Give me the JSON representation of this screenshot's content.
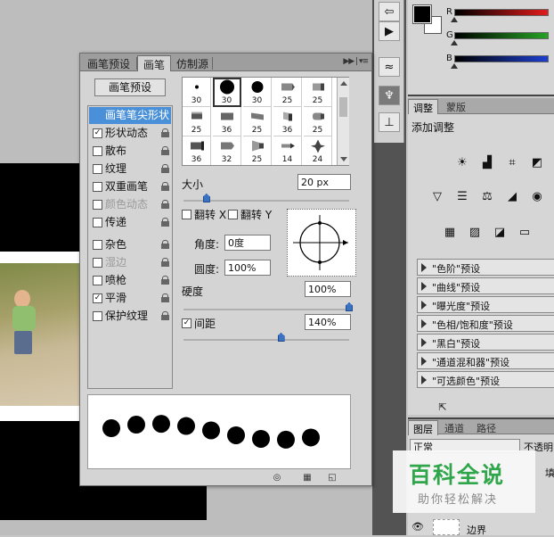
{
  "colors": {
    "accent_blue": "#4a90d9",
    "slider_blue": "#3b73c4",
    "watermark_green": "#2fa64a"
  },
  "brush_dialog": {
    "tabs": [
      {
        "label": "画笔预设"
      },
      {
        "label": "画笔",
        "active": true
      },
      {
        "label": "仿制源"
      }
    ],
    "menu_icon": "panel-menu-icon",
    "preset_button_label": "画笔预设",
    "options": [
      {
        "label": "画笔笔尖形状",
        "checkbox": false,
        "checked": false,
        "selected": true,
        "disabled": false,
        "lock": false
      },
      {
        "label": "形状动态",
        "checkbox": true,
        "checked": true,
        "selected": false,
        "disabled": false,
        "lock": true
      },
      {
        "label": "散布",
        "checkbox": true,
        "checked": false,
        "selected": false,
        "disabled": false,
        "lock": true
      },
      {
        "label": "纹理",
        "checkbox": true,
        "checked": false,
        "selected": false,
        "disabled": false,
        "lock": true
      },
      {
        "label": "双重画笔",
        "checkbox": true,
        "checked": false,
        "selected": false,
        "disabled": false,
        "lock": true
      },
      {
        "label": "颜色动态",
        "checkbox": true,
        "checked": false,
        "selected": false,
        "disabled": true,
        "lock": true
      },
      {
        "label": "传递",
        "checkbox": true,
        "checked": false,
        "selected": false,
        "disabled": false,
        "lock": true
      },
      {
        "label": "杂色",
        "checkbox": true,
        "checked": false,
        "selected": false,
        "disabled": false,
        "lock": true
      },
      {
        "label": "湿边",
        "checkbox": true,
        "checked": false,
        "selected": false,
        "disabled": true,
        "lock": true
      },
      {
        "label": "喷枪",
        "checkbox": true,
        "checked": false,
        "selected": false,
        "disabled": false,
        "lock": true
      },
      {
        "label": "平滑",
        "checkbox": true,
        "checked": true,
        "selected": false,
        "disabled": false,
        "lock": true
      },
      {
        "label": "保护纹理",
        "checkbox": true,
        "checked": false,
        "selected": false,
        "disabled": false,
        "lock": true
      }
    ],
    "brush_tips": [
      {
        "size": "30",
        "shape": "dot-small"
      },
      {
        "size": "30",
        "shape": "dot-large",
        "selected": true
      },
      {
        "size": "30",
        "shape": "dot-medium"
      },
      {
        "size": "25",
        "shape": "arrow-brush"
      },
      {
        "size": "25",
        "shape": "chalk"
      },
      {
        "size": "25",
        "shape": "bristle"
      },
      {
        "size": "36",
        "shape": "flat"
      },
      {
        "size": "25",
        "shape": "fan"
      },
      {
        "size": "36",
        "shape": "angled"
      },
      {
        "size": "25",
        "shape": "round-bristle"
      },
      {
        "size": "36",
        "shape": "thick"
      },
      {
        "size": "32",
        "shape": "wedge"
      },
      {
        "size": "25",
        "shape": "fan-wide"
      },
      {
        "size": "14",
        "shape": "point"
      },
      {
        "size": "24",
        "shape": "leaf"
      }
    ],
    "size_label": "大小",
    "size_value": "20 px",
    "size_fraction": 0.12,
    "flip_x_label": "翻转 X",
    "flip_y_label": "翻转 Y",
    "flip_x": false,
    "flip_y": false,
    "angle_label": "角度:",
    "angle_value": "0度",
    "roundness_label": "圆度:",
    "roundness_value": "100%",
    "hardness_label": "硬度",
    "hardness_value": "100%",
    "hardness_fraction": 1.0,
    "spacing_label": "间距",
    "spacing_checked": true,
    "spacing_value": "140%",
    "spacing_fraction": 0.58,
    "preview_dots": 9,
    "bottom_icons": [
      "eye-brush-icon",
      "grid-icon",
      "new-preset-icon"
    ]
  },
  "color_panel": {
    "channels": [
      {
        "label": "R",
        "color": "#e21b1b",
        "value_fraction": 0
      },
      {
        "label": "G",
        "color": "#25a325",
        "value_fraction": 0
      },
      {
        "label": "B",
        "color": "#1d3fd0",
        "value_fraction": 0
      }
    ]
  },
  "adjust_panel": {
    "tabs": [
      {
        "label": "调整",
        "active": true
      },
      {
        "label": "蒙版",
        "active": false
      }
    ],
    "title": "添加调整",
    "presets": [
      "\"色阶\"预设",
      "\"曲线\"预设",
      "\"曝光度\"预设",
      "\"色相/饱和度\"预设",
      "\"黑白\"预设",
      "\"通道混和器\"预设",
      "\"可选颜色\"预设"
    ]
  },
  "layers_panel": {
    "tabs": [
      {
        "label": "图层",
        "active": true
      },
      {
        "label": "通道",
        "active": false
      },
      {
        "label": "路径",
        "active": false
      }
    ],
    "blend_mode": "正常",
    "opacity_label": "不透明",
    "fill_label": "填",
    "layer_name": "边界"
  },
  "watermark": {
    "title": "百科全说",
    "subtitle": "助你轻松解决"
  }
}
